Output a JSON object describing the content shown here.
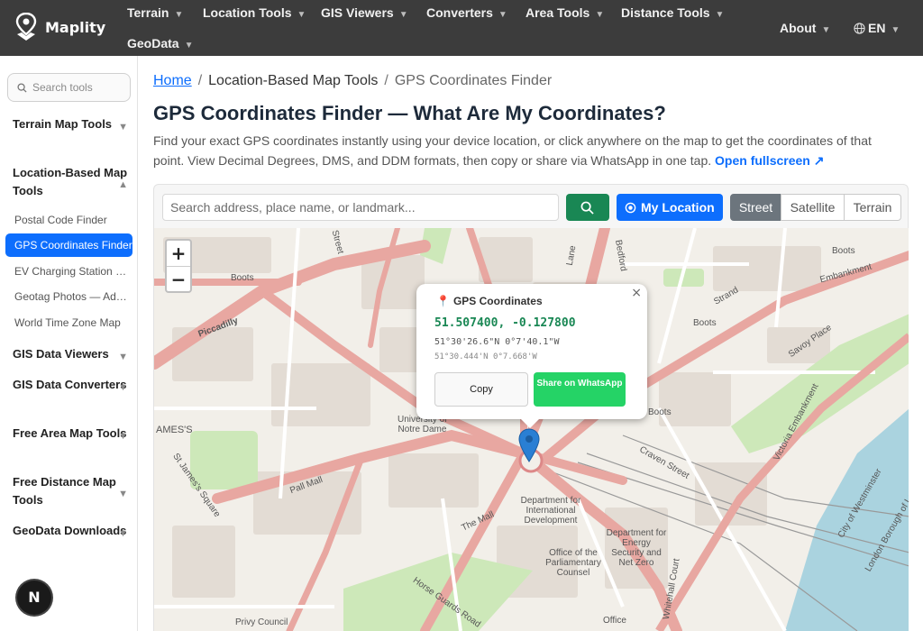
{
  "brand": {
    "name": "Maplity"
  },
  "nav": {
    "items": [
      "Terrain",
      "Location Tools",
      "GIS Viewers",
      "Converters",
      "Area Tools",
      "Distance Tools",
      "GeoData"
    ],
    "about": "About",
    "lang": "EN"
  },
  "sidebar": {
    "search_placeholder": "Search tools",
    "sections": [
      "Terrain Map Tools",
      "Location-Based Map Tools",
      "GIS Data Viewers",
      "GIS Data Converters",
      "Free Area Map Tools",
      "Free Distance Map Tools",
      "GeoData Downloads"
    ],
    "location_sub": [
      "Postal Code Finder",
      "GPS Coordinates Finder",
      "EV Charging Station Finder",
      "Geotag Photos — Add GPS",
      "World Time Zone Map"
    ],
    "fab": "N"
  },
  "breadcrumb": {
    "home": "Home",
    "sep": "/",
    "section": "Location-Based Map Tools",
    "current": "GPS Coordinates Finder"
  },
  "page": {
    "title": "GPS Coordinates Finder — What Are My Coordinates?",
    "description": "Find your exact GPS coordinates instantly using your device location, or click anywhere on the map to get the coordinates of that point. View Decimal Degrees, DMS, and DDM formats, then copy or share via WhatsApp in one tap.",
    "fullscreen_link": "Open fullscreen ↗"
  },
  "toolbar": {
    "search_placeholder": "Search address, place name, or landmark...",
    "my_location": "My Location",
    "layers": [
      "Street",
      "Satellite",
      "Terrain"
    ],
    "active_layer": "Street"
  },
  "map": {
    "zoom_in": "+",
    "zoom_out": "−",
    "labels": {
      "boots1": "Boots",
      "boots2": "Boots",
      "boots3": "Boots",
      "boots4": "Boots",
      "piccadilly": "Piccadilly",
      "pall_mall": "Pall Mall",
      "the_mall": "The Mall",
      "strand": "Strand",
      "savoy": "Savoy Place",
      "craven": "Craven Street",
      "embankment": "Victoria Embankment",
      "james": "AMES'S",
      "st_james_sq": "St James's Square",
      "horse_guards": "Horse Guards Road",
      "whitehall": "Whitehall Court",
      "dept_intl": "Department for International Development",
      "dept_energy": "Department for Energy Security and Net Zero",
      "parl_counsel": "Office of the Parliamentary Counsel",
      "privy": "Privy Council",
      "office": "Office",
      "notre_dame": "University of Notre Dame",
      "city_westminster": "City of Westminster",
      "lambeth": "London Borough of Lambeth",
      "lane": "Lane",
      "bedford": "Bedford",
      "street": "Street",
      "embankment_pl": "Embankment"
    }
  },
  "popup": {
    "title": "GPS Coordinates",
    "decimal": "51.507400, -0.127800",
    "dms": "51°30'26.6\"N 0°7'40.1\"W",
    "ddm": "51°30.444'N 0°7.668'W",
    "copy": "Copy",
    "whatsapp": "Share on WhatsApp",
    "close": "×"
  }
}
